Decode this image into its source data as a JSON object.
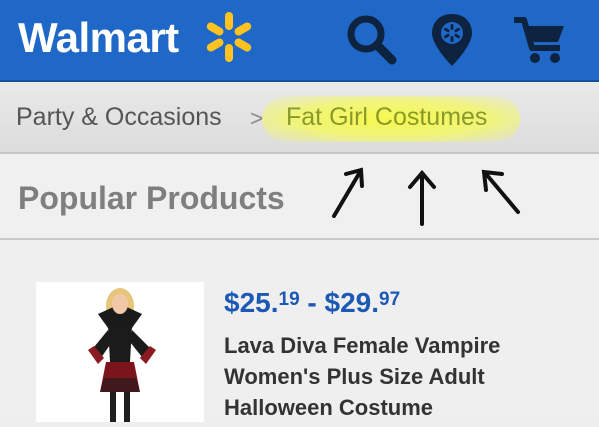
{
  "header": {
    "logo_text": "Walmart",
    "brand_color": "#1f68c7",
    "spark_color": "#ffc220",
    "icons": [
      "search-icon",
      "store-locator-icon",
      "cart-icon"
    ]
  },
  "breadcrumb": {
    "parent": "Party & Occasions",
    "separator": ">",
    "current": "Fat Girl Costumes"
  },
  "section": {
    "title": "Popular Products"
  },
  "annotation": {
    "arrows": [
      "arrow-up-left",
      "arrow-up",
      "arrow-up-right"
    ],
    "highlight_color": "#f7fa46"
  },
  "product": {
    "price_from_dollars": "$25.",
    "price_from_cents": "19",
    "price_dash": " - ",
    "price_to_dollars": "$29.",
    "price_to_cents": "97",
    "name": "Lava Diva Female Vampire Women's Plus Size Adult Halloween Costume",
    "price_color": "#1c58b5"
  }
}
